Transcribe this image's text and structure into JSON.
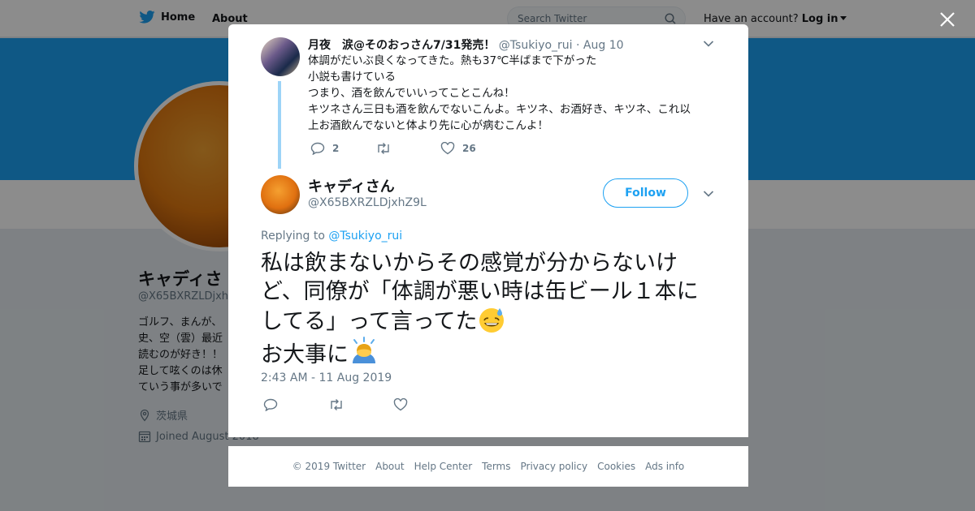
{
  "topbar": {
    "home_label": "Home",
    "about_label": "About",
    "search_placeholder": "Search Twitter",
    "have_account": "Have an account?",
    "login_label": "Log in"
  },
  "profile": {
    "name": "キャディさ",
    "handle": "@X65BXRZLDjxh",
    "bio_lines": [
      "ゴルフ、まんが、",
      "史、空（雲）最近",
      "読むのが好き！！",
      "足して呟くのは休",
      "ていう事が多いで"
    ],
    "location": "茨城県",
    "joined": "Joined August 2018"
  },
  "parent_tweet": {
    "name": "月夜　涙@そのおっさん7/31発売！",
    "handle": "@Tsukiyo_rui",
    "date": "· Aug 10",
    "lines": [
      "体調がだいぶ良くなってきた。熱も37℃半ばまで下がった",
      "小説も書けている",
      "つまり、酒を飲んでいいってことこんね！",
      "キツネさん三日も酒を飲んでないこんよ。キツネ、お酒好き、キツネ、これ以",
      "上お酒飲んでないと体より先に心が病むこんよ！"
    ],
    "reply_count": "2",
    "like_count": "26"
  },
  "main_tweet": {
    "name": "キャディさん",
    "handle": "@X65BXRZLDjxhZ9L",
    "follow_label": "Follow",
    "replying_prefix": "Replying to",
    "replying_to": "@Tsukiyo_rui",
    "lines": [
      "私は飲まないからその感覚が分からないけ",
      "ど、同僚が「体調が悪い時は缶ビール１本に",
      "してる」って言ってた",
      "お大事に"
    ],
    "timestamp": "2:43 AM - 11 Aug 2019"
  },
  "footer": {
    "links": [
      "© 2019 Twitter",
      "About",
      "Help Center",
      "Terms",
      "Privacy policy",
      "Cookies",
      "Ads info"
    ]
  },
  "colors": {
    "brand": "#1da1f2",
    "thread_line": "#9dd4f7",
    "muted": "#657786"
  }
}
